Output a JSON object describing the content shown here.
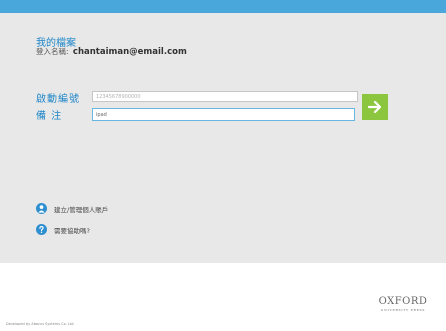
{
  "profile": {
    "title": "我的檔案",
    "login_label": "登入名稱:",
    "login_email": "chantaiman@email.com"
  },
  "form": {
    "code_label": "啟動編號",
    "code_placeholder": "12345678900000",
    "note_label": "備 注",
    "note_value": "ipad"
  },
  "links": {
    "manage_accounts": "建立/管理個人賬戶",
    "help": "需要協助嗎?"
  },
  "footer": {
    "logo_main": "OXFORD",
    "logo_sub": "UNIVERSITY PRESS",
    "developer": "Developed by Abacus Systems Co. Ltd."
  },
  "colors": {
    "header_bar": "#4aa7dc",
    "panel_bg": "#e8e8e8",
    "accent_blue": "#1e86c8",
    "submit_green": "#8cc63f"
  },
  "icons": {
    "submit": "arrow-right-icon",
    "account": "user-icon",
    "help": "question-icon"
  }
}
